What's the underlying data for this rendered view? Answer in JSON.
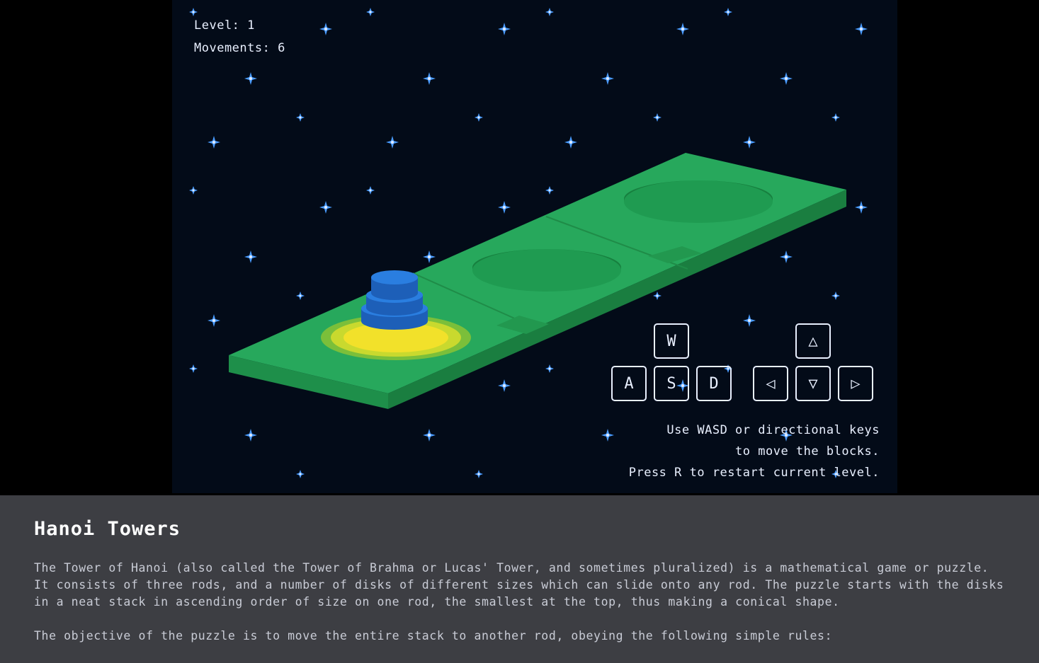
{
  "hud": {
    "level_label": "Level: 1",
    "movements_label": "Movements: 6"
  },
  "controls": {
    "wasd": {
      "up": "W",
      "left": "A",
      "down": "S",
      "right": "D"
    },
    "arrows": {
      "up": "△",
      "left": "◁",
      "down": "▽",
      "right": "▷"
    },
    "help_lines": [
      "Use WASD or directional keys",
      "to move the blocks.",
      "Press R to restart current level."
    ]
  },
  "board": {
    "rods": 3,
    "disks_on_rod": [
      3,
      0,
      0
    ],
    "selected_rod": 1
  },
  "colors": {
    "background": "#030b18",
    "board_top": "#27a85c",
    "board_side": "#1a7e40",
    "disk": "#2a7ee0",
    "highlight": "#f2e12a",
    "star": "#4a9cff",
    "info_panel": "#3d3e43"
  },
  "info": {
    "title": "Hanoi Towers",
    "paragraphs": [
      "The Tower of Hanoi (also called the Tower of Brahma or Lucas' Tower, and sometimes pluralized) is a mathematical game or puzzle. It consists of three rods, and a number of disks of different sizes which can slide onto any rod. The puzzle starts with the disks in a neat stack in ascending order of size on one rod, the smallest at the top, thus making a conical shape.",
      "The objective of the puzzle is to move the entire stack to another rod, obeying the following simple rules:"
    ]
  }
}
